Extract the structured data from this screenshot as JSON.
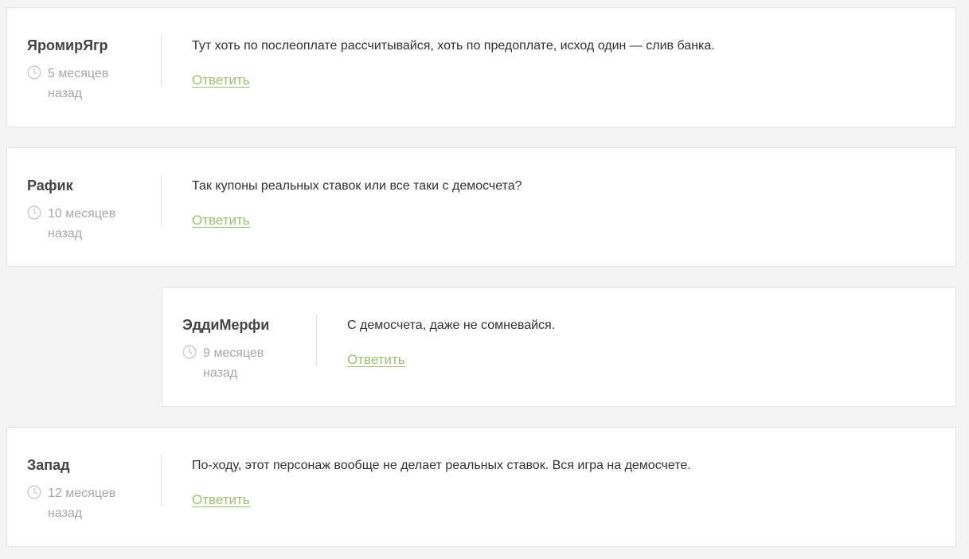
{
  "colors": {
    "page_bg": "#f4f4f4",
    "card_bg": "#ffffff",
    "author": "#444444",
    "meta": "#a7a7a7",
    "text": "#333333",
    "reply_link": "#9dc36e"
  },
  "comments": [
    {
      "author": "ЯромирЯгр",
      "time": "5 месяцев назад",
      "text": "Тут хоть по послеоплате рассчитывайся, хоть по предоплате, исход один — слив банка.",
      "reply_label": "Ответить",
      "is_reply": false
    },
    {
      "author": "Рафик",
      "time": "10 месяцев назад",
      "text": "Так купоны реальных ставок или все таки с демосчета?",
      "reply_label": "Ответить",
      "is_reply": false
    },
    {
      "author": "ЭддиМерфи",
      "time": "9 месяцев назад",
      "text": "С демосчета, даже не сомневайся.",
      "reply_label": "Ответить",
      "is_reply": true
    },
    {
      "author": "Запад",
      "time": "12 месяцев назад",
      "text": "По-ходу, этот персонаж вообще не делает реальных ставок. Вся игра на демосчете.",
      "reply_label": "Ответить",
      "is_reply": false
    }
  ]
}
